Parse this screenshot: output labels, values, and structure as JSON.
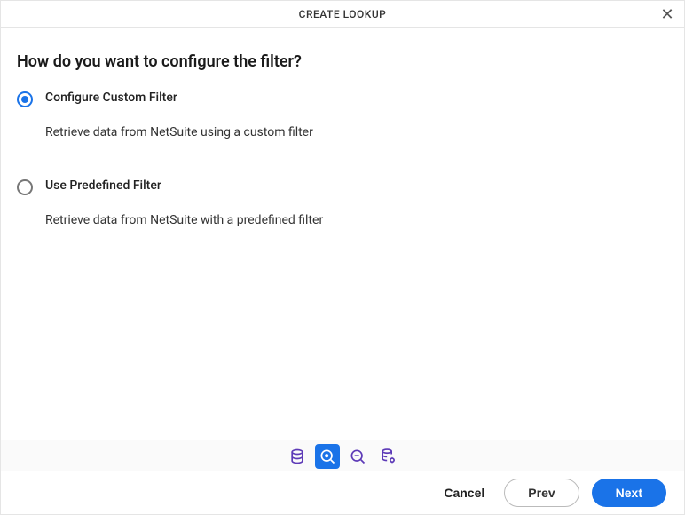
{
  "header": {
    "title": "CREATE LOOKUP",
    "close_label": "✕"
  },
  "question": "How do you want to configure the filter?",
  "options": [
    {
      "label": "Configure Custom Filter",
      "description": "Retrieve data from NetSuite using a custom filter",
      "selected": true
    },
    {
      "label": "Use Predefined Filter",
      "description": "Retrieve data from NetSuite with a predefined filter",
      "selected": false
    }
  ],
  "steps": {
    "items": [
      "database",
      "search-settings",
      "zoom-out",
      "database-settings"
    ],
    "active_index": 1
  },
  "footer": {
    "cancel": "Cancel",
    "prev": "Prev",
    "next": "Next"
  },
  "colors": {
    "primary": "#1a73e8",
    "accent_purple": "#5d3ab7"
  }
}
